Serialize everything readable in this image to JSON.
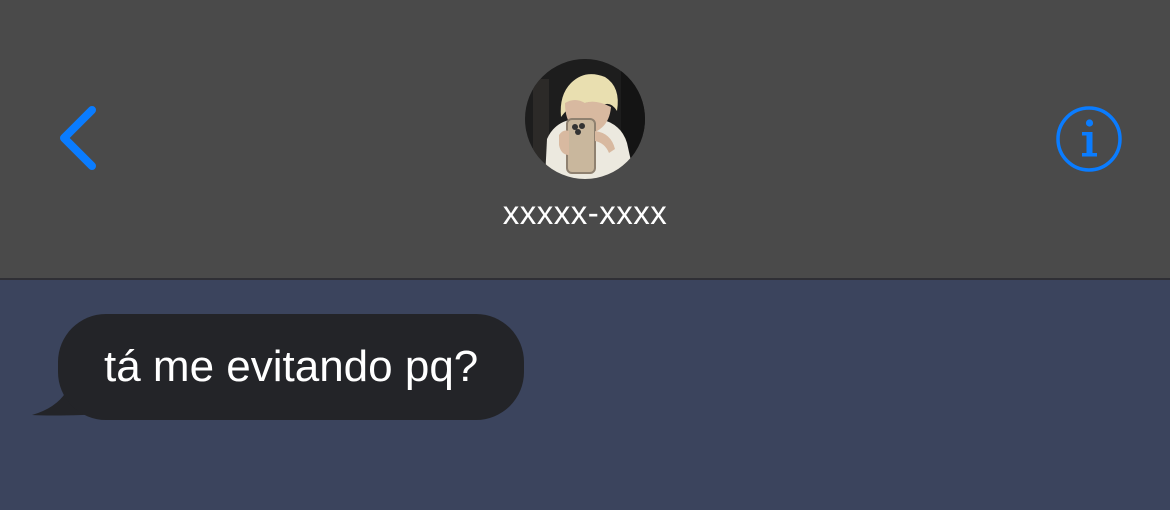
{
  "colors": {
    "header_bg": "#4a4a4a",
    "chat_bg": "#3b445d",
    "accent": "#0a7cff",
    "bubble_bg": "#232428",
    "text": "#ffffff"
  },
  "header": {
    "back_icon": "chevron-left-icon",
    "contact_name": "xxxxx-xxxx",
    "avatar_icon": "contact-photo",
    "info_icon": "info-circle-icon"
  },
  "messages": [
    {
      "direction": "incoming",
      "text": "tá me evitando pq?"
    }
  ]
}
